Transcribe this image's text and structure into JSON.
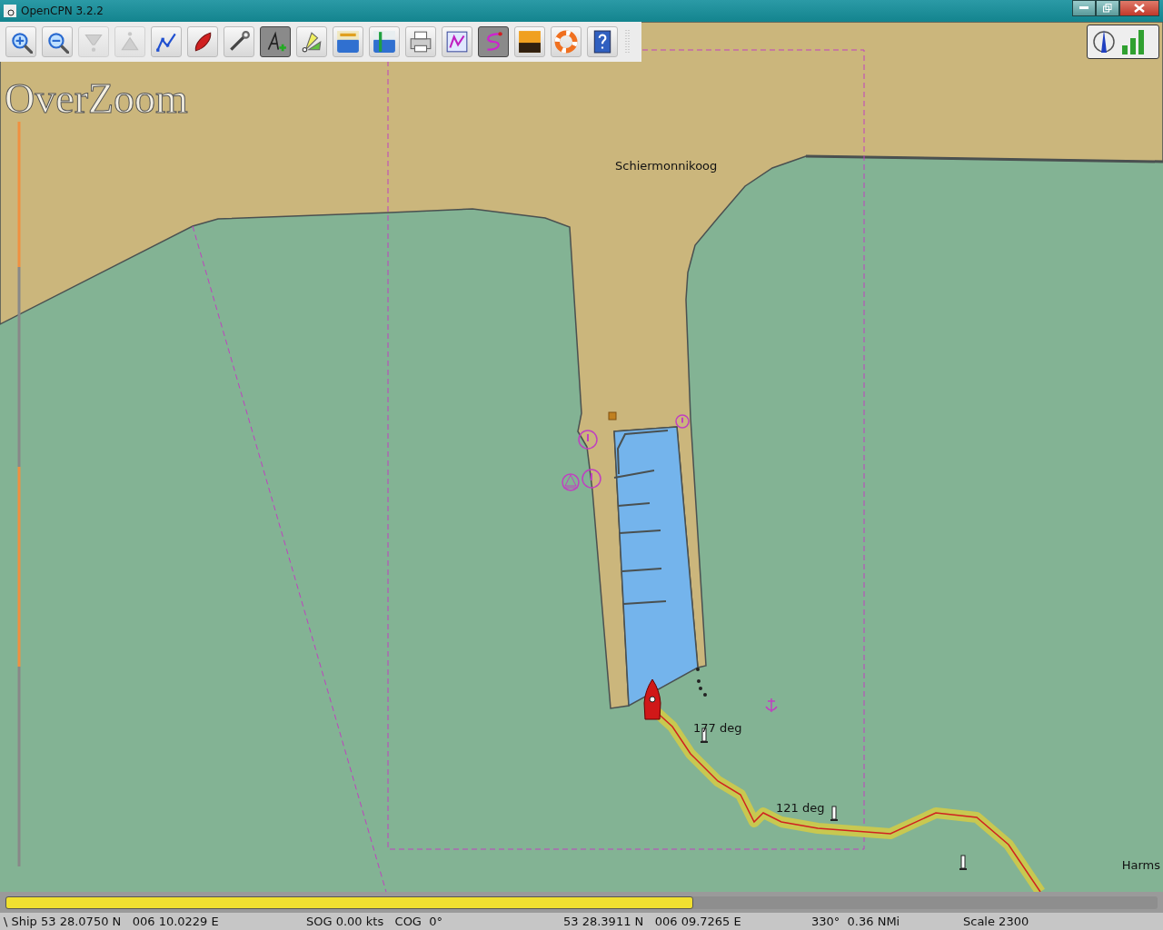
{
  "window": {
    "title": "OpenCPN 3.2.2"
  },
  "toolbar": [
    {
      "kind": "zoom-in",
      "selected": false,
      "disabled": false
    },
    {
      "kind": "zoom-out",
      "selected": false,
      "disabled": false
    },
    {
      "kind": "funnel",
      "selected": false,
      "disabled": true
    },
    {
      "kind": "triangle",
      "selected": false,
      "disabled": true
    },
    {
      "kind": "route",
      "selected": false,
      "disabled": false
    },
    {
      "kind": "boat",
      "selected": false,
      "disabled": false
    },
    {
      "kind": "wrench",
      "selected": false,
      "disabled": false
    },
    {
      "kind": "text",
      "selected": true,
      "disabled": false
    },
    {
      "kind": "flags",
      "selected": false,
      "disabled": false
    },
    {
      "kind": "tide",
      "selected": false,
      "disabled": false
    },
    {
      "kind": "current",
      "selected": false,
      "disabled": false
    },
    {
      "kind": "print",
      "selected": false,
      "disabled": false
    },
    {
      "kind": "route-manager",
      "selected": false,
      "disabled": false
    },
    {
      "kind": "track",
      "selected": true,
      "disabled": false
    },
    {
      "kind": "sunset",
      "selected": false,
      "disabled": false
    },
    {
      "kind": "lifebuoy",
      "selected": false,
      "disabled": false
    },
    {
      "kind": "help",
      "selected": false,
      "disabled": false
    }
  ],
  "map": {
    "overlay_text": "OverZoom",
    "labels": [
      "Schiermonnikoog",
      "177 deg",
      "121 deg",
      "Harms"
    ]
  },
  "progress": {
    "level": 0.597
  },
  "status_bar": [
    "\\ Ship 53 28.0750 N   006 10.0229 E",
    "SOG 0.00 kts   COG  0°",
    "53 28.3911 N   006 09.7265 E",
    "330°  0.36 NMi",
    "Scale 2300"
  ]
}
